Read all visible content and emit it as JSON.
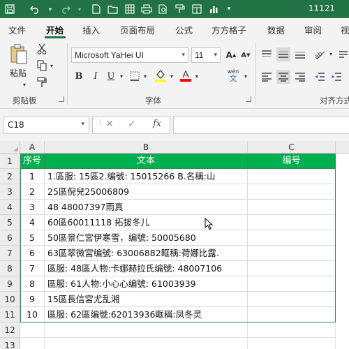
{
  "titlebar": {
    "title": "11121",
    "bg_color": "#217346",
    "icons": [
      "save-icon",
      "undo-icon",
      "undo-dropdown-icon",
      "redo-icon",
      "redo-dropdown-icon",
      "new-file-icon",
      "open-file-icon",
      "grid-icon",
      "print-icon",
      "print-preview-icon",
      "format-painter-icon",
      "table-icon",
      "chart-icon",
      "customize-toolbar-icon"
    ]
  },
  "ribbon_tabs": [
    "文件",
    "开始",
    "插入",
    "页面布局",
    "公式",
    "方方格子",
    "数据",
    "审阅",
    "视"
  ],
  "active_tab": "开始",
  "clipboard": {
    "paste_label": "粘贴",
    "group_label": "剪贴板"
  },
  "font": {
    "family": "Microsoft YaHei UI",
    "size": "11",
    "group_label": "字体",
    "bold": "B",
    "italic": "I",
    "underline": "U",
    "font_color_glyph": "A",
    "fill_color": "#ffff00",
    "font_color": "#ff0000",
    "phonetic_top": "wén",
    "phonetic_bottom": "文"
  },
  "alignment": {
    "group_label": "对齐方式"
  },
  "formula_bar": {
    "name_box": "C18",
    "cancel_glyph": "✕",
    "enter_glyph": "✓",
    "fx_glyph": "fx",
    "formula": ""
  },
  "columns": [
    "A",
    "B",
    "C"
  ],
  "rows": [
    "1",
    "2",
    "3",
    "4",
    "5",
    "6",
    "7",
    "8",
    "9",
    "10",
    "11",
    "12",
    "13"
  ],
  "table": {
    "header_color": "#00b050",
    "headers": [
      "序号",
      "文本",
      "编号"
    ],
    "data": [
      [
        "1",
        "1.區服: 15區2.编號: 15015266 B.名稱:山",
        ""
      ],
      [
        "2",
        "25區倪兒25006809",
        ""
      ],
      [
        "3",
        "48 48007397雨真",
        ""
      ],
      [
        "4",
        "60區60011118 拓拔冬儿",
        ""
      ],
      [
        "5",
        "50區景仁宮伊寒雪，编號: 50005680",
        ""
      ],
      [
        "6",
        "63區翠微宮编號: 63006882眶稱:荷娜比露.",
        ""
      ],
      [
        "7",
        "區服: 48區人物:卡娜赫拉氏编號: 48007106",
        ""
      ],
      [
        "8",
        "區服: 61人物:小心心编號: 61003939",
        ""
      ],
      [
        "9",
        "15區長信宮尤乱湘",
        ""
      ],
      [
        "10",
        "區服: 62區编號:62013936眶稱:凤冬灵",
        ""
      ]
    ]
  }
}
